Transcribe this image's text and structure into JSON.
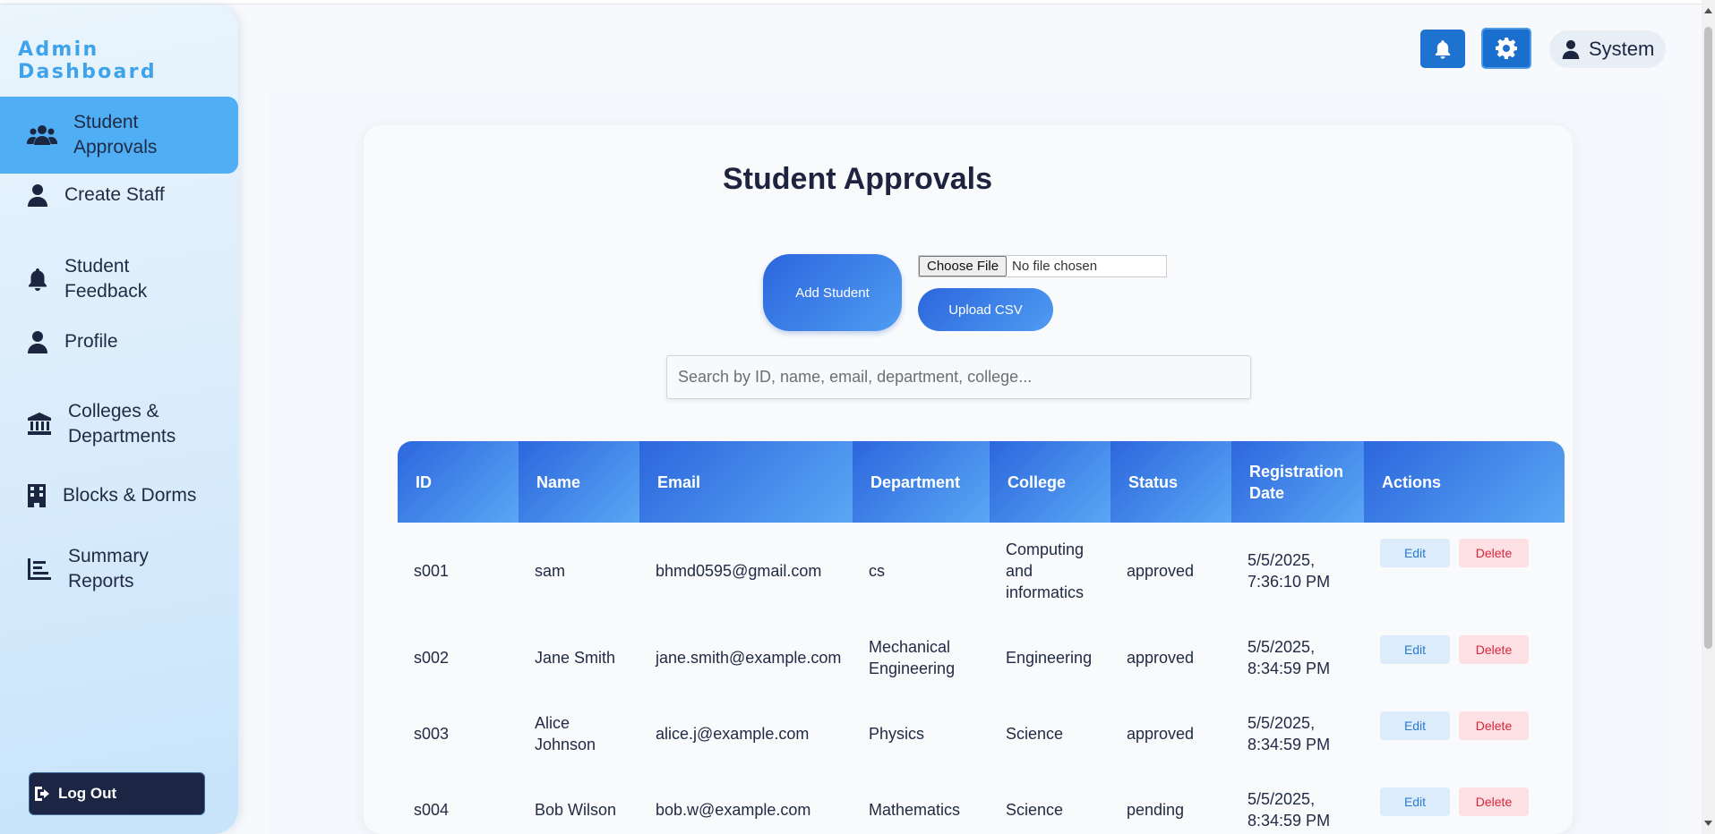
{
  "sidebar": {
    "brand": "Admin Dashboard",
    "items": [
      {
        "label": "Student Approvals",
        "icon": "users-icon",
        "active": true
      },
      {
        "label": "Create Staff",
        "icon": "user-icon"
      },
      {
        "label": "Student Feedback",
        "icon": "bell-icon"
      },
      {
        "label": "Profile",
        "icon": "user-icon"
      },
      {
        "label": "Colleges & Departments",
        "icon": "bank-icon"
      },
      {
        "label": "Blocks & Dorms",
        "icon": "building-icon"
      },
      {
        "label": "Summary Reports",
        "icon": "chart-icon"
      }
    ],
    "logout_label": "Log Out"
  },
  "header": {
    "user_label": "System"
  },
  "main": {
    "title": "Student Approvals",
    "add_student_label": "Add Student",
    "choose_file_label": "Choose File",
    "file_status": "No file chosen",
    "upload_label": "Upload CSV",
    "search_placeholder": "Search by ID, name, email, department, college..."
  },
  "table": {
    "columns": [
      "ID",
      "Name",
      "Email",
      "Department",
      "College",
      "Status",
      "Registration Date",
      "Actions"
    ],
    "edit_label": "Edit",
    "delete_label": "Delete",
    "rows": [
      {
        "id": "s001",
        "name": "sam",
        "email": "bhmd0595@gmail.com",
        "department": "cs",
        "college": "Computing and informatics",
        "status": "approved",
        "date": "5/5/2025, 7:36:10 PM"
      },
      {
        "id": "s002",
        "name": "Jane Smith",
        "email": "jane.smith@example.com",
        "department": "Mechanical Engineering",
        "college": "Engineering",
        "status": "approved",
        "date": "5/5/2025, 8:34:59 PM"
      },
      {
        "id": "s003",
        "name": "Alice Johnson",
        "email": "alice.j@example.com",
        "department": "Physics",
        "college": "Science",
        "status": "approved",
        "date": "5/5/2025, 8:34:59 PM"
      },
      {
        "id": "s004",
        "name": "Bob Wilson",
        "email": "bob.w@example.com",
        "department": "Mathematics",
        "college": "Science",
        "status": "pending",
        "date": "5/5/2025, 8:34:59 PM"
      }
    ]
  },
  "colors": {
    "brand": "#3ea3ea",
    "primary": "#1e73d0",
    "active_nav": "#50aef5",
    "edit": "#2b7bd0",
    "delete": "#d9253a"
  }
}
